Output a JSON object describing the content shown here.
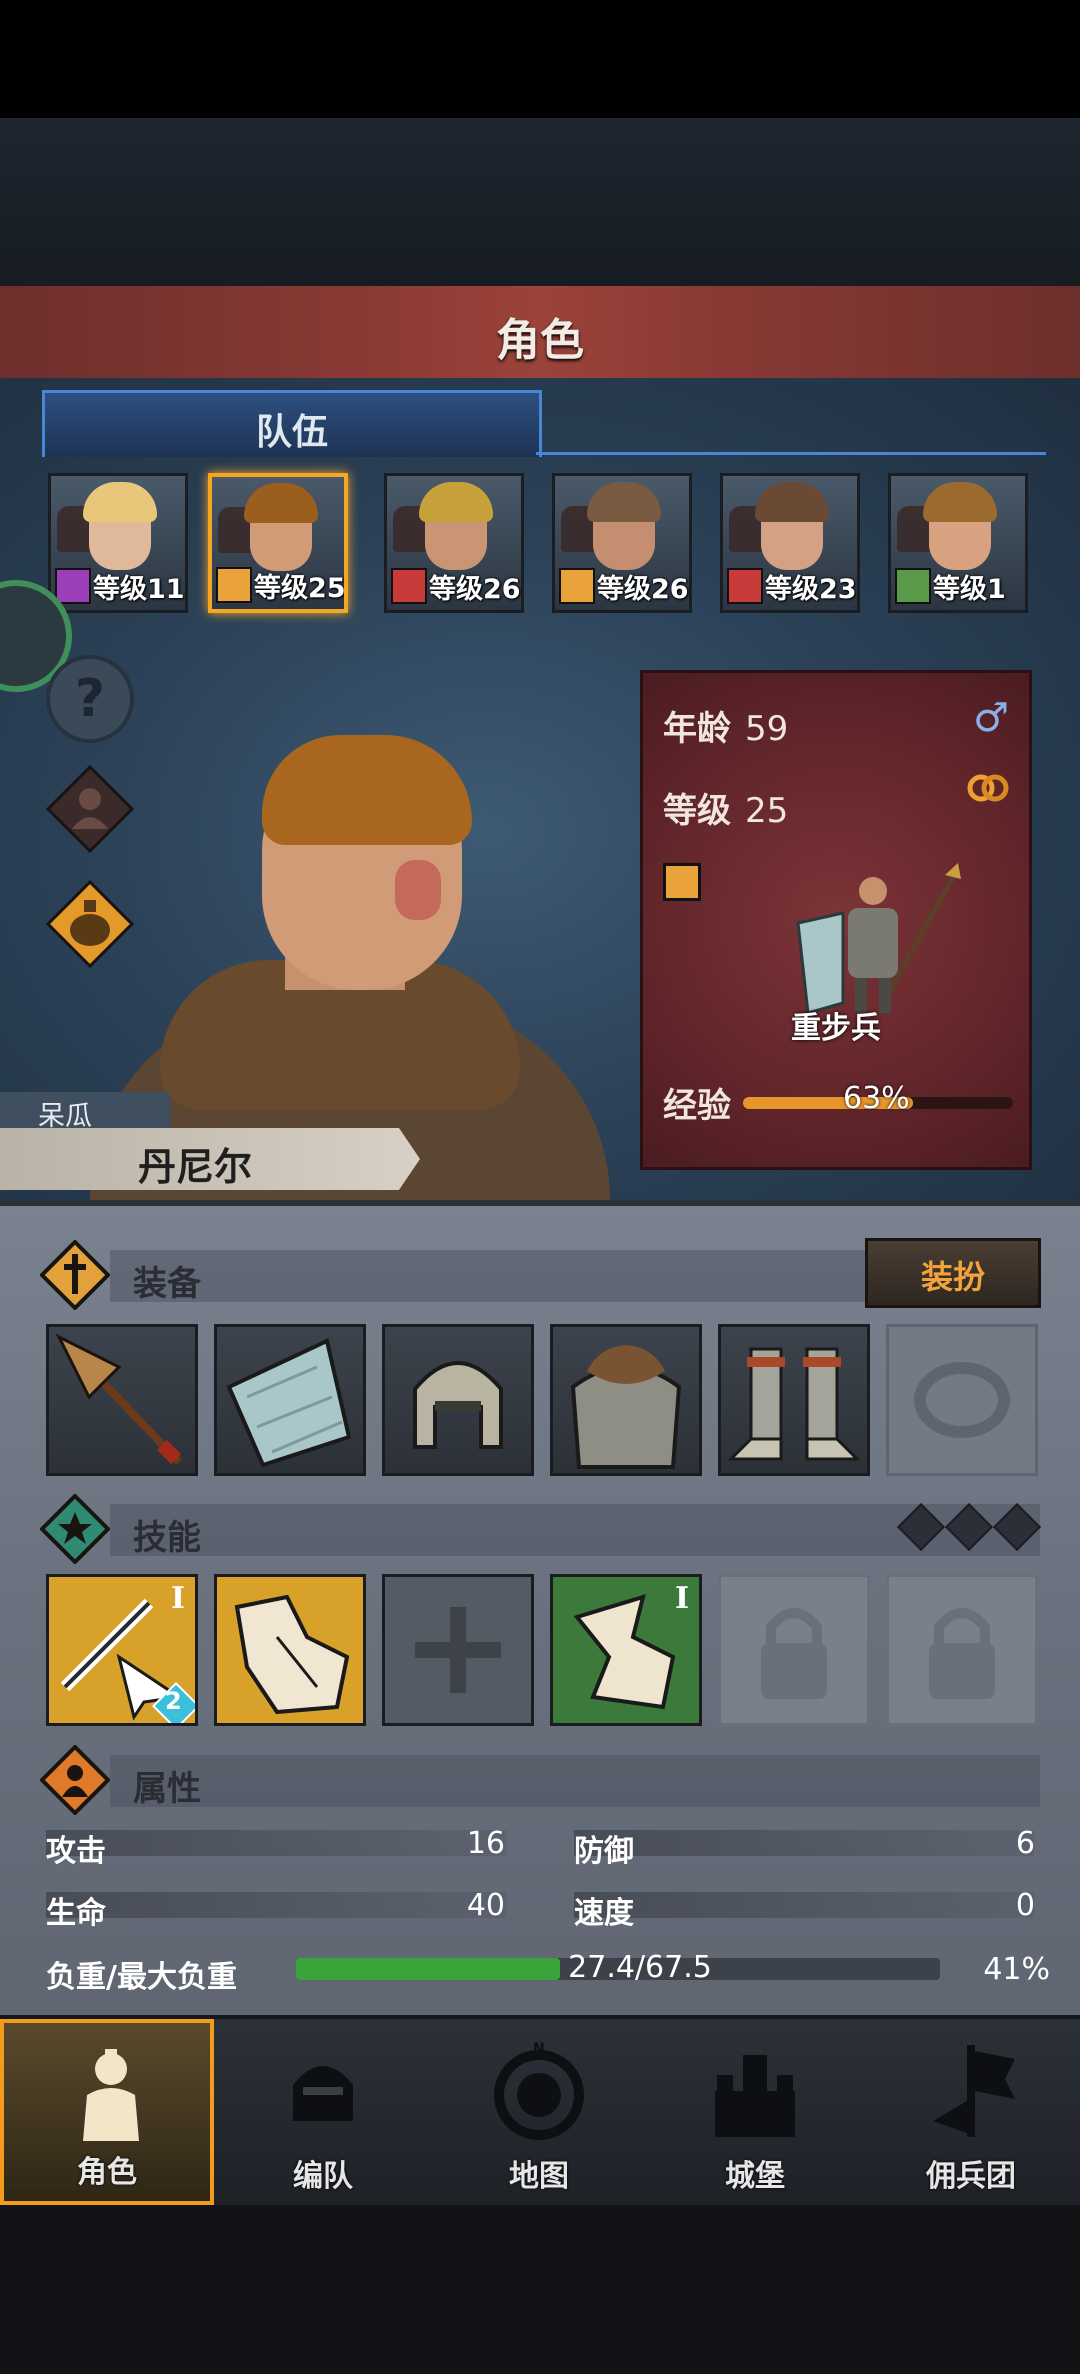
{
  "header": {
    "title": "角色"
  },
  "team": {
    "tab_label": "队伍",
    "members": [
      {
        "level": "等级11",
        "class_color": "#9b3fb8",
        "class_icon": "staff-icon",
        "hair": "#e8c77a",
        "selected": false
      },
      {
        "level": "等级25",
        "class_color": "#e9a33a",
        "class_icon": "shield-icon",
        "hair": "#9a5e1e",
        "selected": true
      },
      {
        "level": "等级26",
        "class_color": "#c83a3a",
        "class_icon": "horse-icon",
        "hair": "#c6a13a",
        "selected": false
      },
      {
        "level": "等级26",
        "class_color": "#e9a33a",
        "class_icon": "shield-icon",
        "hair": "#7a5a40",
        "selected": false
      },
      {
        "level": "等级23",
        "class_color": "#c83a3a",
        "class_icon": "horse-icon",
        "hair": "#6a4a34",
        "selected": false
      },
      {
        "level": "等级1",
        "class_color": "#5a9a4a",
        "class_icon": "crossbow-icon",
        "hair": "#9a6a2e",
        "selected": false
      }
    ]
  },
  "character": {
    "nickname": "呆瓜",
    "name": "丹尼尔",
    "age_label": "年龄",
    "age": "59",
    "level_label": "等级",
    "level": "25",
    "unit_type": "重步兵",
    "xp_label": "经验",
    "xp_percent": "63%",
    "xp_fraction": 0.63
  },
  "equipment": {
    "title": "装备",
    "dress_button": "装扮",
    "slots": [
      "spear-icon",
      "shield-icon",
      "helmet-icon",
      "chainmail-icon",
      "boots-icon",
      "ring-icon"
    ]
  },
  "skills": {
    "title": "技能",
    "slots": [
      {
        "icon": "sword-strike-icon",
        "rank": "I",
        "badge": "2",
        "style": "gold"
      },
      {
        "icon": "gauntlet-icon",
        "rank": "",
        "badge": "",
        "style": "gold"
      },
      {
        "icon": "cross-icon",
        "rank": "",
        "badge": "",
        "style": "add"
      },
      {
        "icon": "boot-icon",
        "rank": "I",
        "badge": "",
        "style": "green"
      },
      {
        "icon": "lock-icon",
        "rank": "",
        "badge": "",
        "style": "lock"
      },
      {
        "icon": "lock-icon",
        "rank": "",
        "badge": "",
        "style": "lock"
      }
    ]
  },
  "attributes": {
    "title": "属性",
    "attack_label": "攻击",
    "attack": "16",
    "defense_label": "防御",
    "defense": "6",
    "hp_label": "生命",
    "hp": "40",
    "speed_label": "速度",
    "speed": "0",
    "load_label": "负重/最大负重",
    "load_value": "27.4/67.5",
    "load_percent": "41%",
    "load_fraction": 0.41
  },
  "nav": {
    "items": [
      {
        "label": "角色",
        "icon": "knight-icon",
        "active": true
      },
      {
        "label": "编队",
        "icon": "helmet-icon",
        "active": false
      },
      {
        "label": "地图",
        "icon": "compass-map-icon",
        "active": false
      },
      {
        "label": "城堡",
        "icon": "castle-icon",
        "active": false
      },
      {
        "label": "佣兵团",
        "icon": "banner-icon",
        "active": false
      }
    ]
  },
  "colors": {
    "accent_orange": "#f39b1d",
    "tab_blue": "#4a86d6",
    "title_red": "#8b3a34",
    "card_red": "#6a2a2e"
  }
}
